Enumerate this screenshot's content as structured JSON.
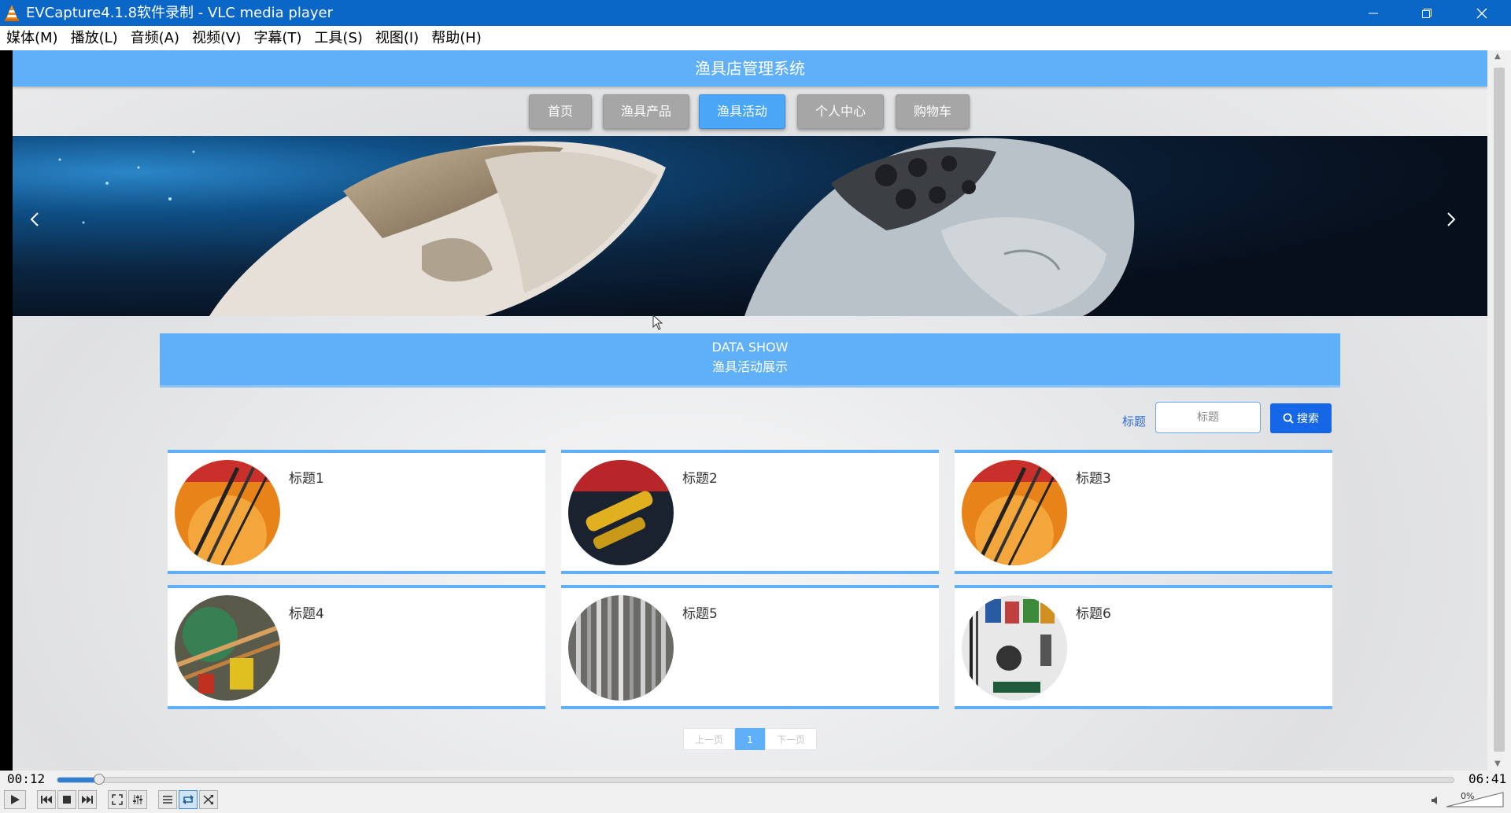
{
  "window": {
    "title": "EVCapture4.1.8软件录制 - VLC media player"
  },
  "menu": [
    "媒体(M)",
    "播放(L)",
    "音频(A)",
    "视频(V)",
    "字幕(T)",
    "工具(S)",
    "视图(I)",
    "帮助(H)"
  ],
  "site": {
    "header_title": "渔具店管理系统",
    "nav": [
      {
        "label": "首页",
        "active": false
      },
      {
        "label": "渔具产品",
        "active": false
      },
      {
        "label": "渔具活动",
        "active": true
      },
      {
        "label": "个人中心",
        "active": false
      },
      {
        "label": "购物车",
        "active": false
      }
    ],
    "section": {
      "line1": "DATA SHOW",
      "line2": "渔具活动展示"
    },
    "search": {
      "label": "标题",
      "placeholder": "标题",
      "button": "搜索"
    },
    "cards": [
      {
        "title": "标题1",
        "image": "fishing-rods-orange"
      },
      {
        "title": "标题2",
        "image": "fishing-reel-promo"
      },
      {
        "title": "标题3",
        "image": "fishing-rods-orange"
      },
      {
        "title": "标题4",
        "image": "fishing-nets"
      },
      {
        "title": "标题5",
        "image": "rod-rack"
      },
      {
        "title": "标题6",
        "image": "tackle-wall"
      }
    ],
    "pagination": {
      "prev": "上一页",
      "current": "1",
      "next": "下一页"
    }
  },
  "player": {
    "elapsed": "00:12",
    "total": "06:41",
    "progress_fraction": 0.03,
    "volume": "0%"
  },
  "colors": {
    "titlebar": "#0a67c7",
    "site_blue": "#5fb0f8",
    "search_button": "#1567e8"
  }
}
